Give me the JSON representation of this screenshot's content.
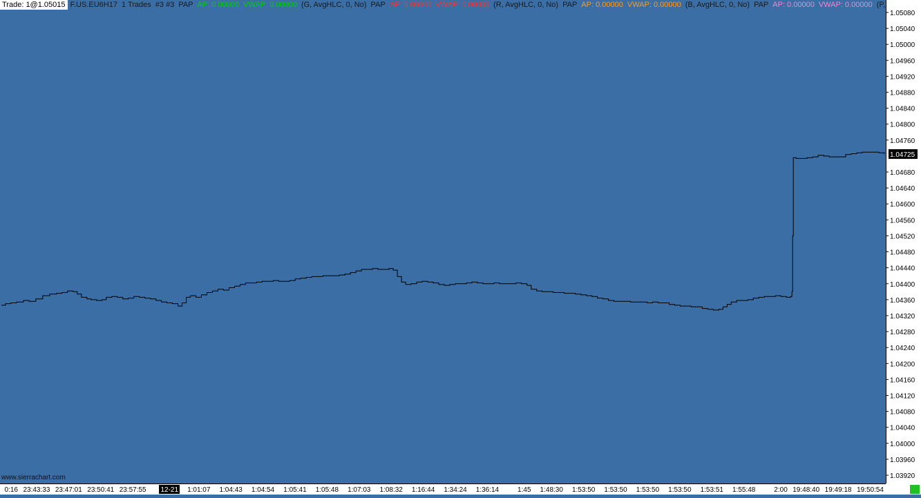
{
  "header": {
    "trade_label": "Trade: 1@1.05015",
    "symbol": "F.US.EU6H17",
    "trades": "1 Trades",
    "chart_id": "#3 #3",
    "items": [
      {
        "text": "PAP",
        "color": "#1a1a1a"
      },
      {
        "text": "AP: 0.00000",
        "color": "#00d000"
      },
      {
        "text": "VWAP: 0.00000",
        "color": "#00d000"
      },
      {
        "text": "(G, AvgHLC, 0, No)",
        "color": "#1a1a1a"
      },
      {
        "text": "PAP",
        "color": "#1a1a1a"
      },
      {
        "text": "AP: 0.00000",
        "color": "#ff3030"
      },
      {
        "text": "VWAP: 0.00000",
        "color": "#ff3030"
      },
      {
        "text": "(R, AvgHLC, 0, No)",
        "color": "#1a1a1a"
      },
      {
        "text": "PAP",
        "color": "#1a1a1a"
      },
      {
        "text": "AP: 0.00000",
        "color": "#ff9a1a"
      },
      {
        "text": "VWAP: 0.00000",
        "color": "#ff9a1a"
      },
      {
        "text": "(B, AvgHLC, 0, No)",
        "color": "#1a1a1a"
      },
      {
        "text": "PAP",
        "color": "#1a1a1a"
      },
      {
        "text": "AP: 0.00000",
        "color": "#ff80d0"
      },
      {
        "text": "VWAP: 0.00000",
        "color": "#ff80d0"
      },
      {
        "text": "(P, A",
        "color": "#1a1a1a"
      }
    ]
  },
  "watermark": "www.sierrachart.com",
  "chart_data": {
    "type": "line",
    "title": "",
    "ylim": [
      1.039,
      1.051
    ],
    "y_ticks": [
      "1.05080",
      "1.05040",
      "1.05000",
      "1.04960",
      "1.04920",
      "1.04880",
      "1.04840",
      "1.04800",
      "1.04760",
      "1.04680",
      "1.04640",
      "1.04600",
      "1.04560",
      "1.04520",
      "1.04480",
      "1.04440",
      "1.04400",
      "1.04360",
      "1.04320",
      "1.04280",
      "1.04240",
      "1.04200",
      "1.04160",
      "1.04120",
      "1.04080",
      "1.04040",
      "1.04000",
      "1.03960",
      "1.03920"
    ],
    "last_price": "1.04725",
    "x_ticks": [
      "0:16",
      "23:43:33",
      "23:47:01",
      "23:50:41",
      "23:57:55",
      "12-21",
      "1:01:07",
      "1:04:43",
      "1:04:54",
      "1:05:41",
      "1:05:48",
      "1:07:03",
      "1:08:32",
      "1:16:44",
      "1:34:24",
      "1:36:14",
      "1:45",
      "1:48:30",
      "1:53:50",
      "1:53:50",
      "1:53:50",
      "1:53:50",
      "1:53:51",
      "1:55:48",
      "2:00",
      "19:48:40",
      "19:49:18",
      "19:50:54"
    ],
    "date_marker_index": 5,
    "bar_index_end": 1280,
    "series": [
      {
        "color": "#000000",
        "points": [
          [
            0,
            1.04346
          ],
          [
            6,
            1.0435
          ],
          [
            14,
            1.04352
          ],
          [
            22,
            1.04354
          ],
          [
            32,
            1.04358
          ],
          [
            40,
            1.04356
          ],
          [
            50,
            1.04362
          ],
          [
            60,
            1.0437
          ],
          [
            70,
            1.04374
          ],
          [
            80,
            1.04376
          ],
          [
            88,
            1.04378
          ],
          [
            96,
            1.04382
          ],
          [
            104,
            1.0438
          ],
          [
            110,
            1.04374
          ],
          [
            116,
            1.04366
          ],
          [
            124,
            1.04362
          ],
          [
            130,
            1.0436
          ],
          [
            138,
            1.04358
          ],
          [
            146,
            1.0436
          ],
          [
            152,
            1.04366
          ],
          [
            160,
            1.04368
          ],
          [
            168,
            1.04366
          ],
          [
            176,
            1.04362
          ],
          [
            184,
            1.04364
          ],
          [
            192,
            1.04368
          ],
          [
            200,
            1.04366
          ],
          [
            208,
            1.04364
          ],
          [
            216,
            1.04362
          ],
          [
            224,
            1.04358
          ],
          [
            232,
            1.04354
          ],
          [
            240,
            1.04352
          ],
          [
            248,
            1.0435
          ],
          [
            256,
            1.04344
          ],
          [
            262,
            1.04352
          ],
          [
            268,
            1.04366
          ],
          [
            274,
            1.0437
          ],
          [
            282,
            1.04366
          ],
          [
            290,
            1.04372
          ],
          [
            298,
            1.04378
          ],
          [
            306,
            1.04382
          ],
          [
            314,
            1.04386
          ],
          [
            322,
            1.04384
          ],
          [
            330,
            1.0439
          ],
          [
            338,
            1.04394
          ],
          [
            346,
            1.04398
          ],
          [
            354,
            1.04402
          ],
          [
            362,
            1.04402
          ],
          [
            370,
            1.04404
          ],
          [
            378,
            1.04406
          ],
          [
            386,
            1.04406
          ],
          [
            394,
            1.04408
          ],
          [
            402,
            1.04406
          ],
          [
            410,
            1.04406
          ],
          [
            418,
            1.04408
          ],
          [
            426,
            1.04412
          ],
          [
            434,
            1.04414
          ],
          [
            442,
            1.04416
          ],
          [
            450,
            1.04418
          ],
          [
            458,
            1.04418
          ],
          [
            466,
            1.0442
          ],
          [
            474,
            1.0442
          ],
          [
            482,
            1.0442
          ],
          [
            490,
            1.04422
          ],
          [
            498,
            1.04424
          ],
          [
            506,
            1.04428
          ],
          [
            514,
            1.04432
          ],
          [
            522,
            1.04436
          ],
          [
            530,
            1.04436
          ],
          [
            538,
            1.04438
          ],
          [
            546,
            1.04436
          ],
          [
            554,
            1.04436
          ],
          [
            562,
            1.04438
          ],
          [
            568,
            1.04434
          ],
          [
            574,
            1.04418
          ],
          [
            580,
            1.04404
          ],
          [
            586,
            1.04398
          ],
          [
            594,
            1.044
          ],
          [
            602,
            1.04404
          ],
          [
            610,
            1.04406
          ],
          [
            618,
            1.04404
          ],
          [
            626,
            1.04402
          ],
          [
            634,
            1.04398
          ],
          [
            642,
            1.04396
          ],
          [
            650,
            1.04398
          ],
          [
            658,
            1.044
          ],
          [
            666,
            1.044
          ],
          [
            674,
            1.04402
          ],
          [
            682,
            1.04404
          ],
          [
            690,
            1.04402
          ],
          [
            698,
            1.044
          ],
          [
            706,
            1.044
          ],
          [
            714,
            1.04402
          ],
          [
            722,
            1.044
          ],
          [
            730,
            1.044
          ],
          [
            738,
            1.044
          ],
          [
            746,
            1.04402
          ],
          [
            754,
            1.044
          ],
          [
            762,
            1.04396
          ],
          [
            768,
            1.04386
          ],
          [
            776,
            1.04382
          ],
          [
            784,
            1.0438
          ],
          [
            792,
            1.0438
          ],
          [
            800,
            1.04378
          ],
          [
            808,
            1.04378
          ],
          [
            816,
            1.04376
          ],
          [
            824,
            1.04376
          ],
          [
            832,
            1.04374
          ],
          [
            840,
            1.04372
          ],
          [
            848,
            1.0437
          ],
          [
            856,
            1.04368
          ],
          [
            864,
            1.04364
          ],
          [
            872,
            1.04362
          ],
          [
            880,
            1.04358
          ],
          [
            888,
            1.04356
          ],
          [
            896,
            1.04356
          ],
          [
            904,
            1.04356
          ],
          [
            912,
            1.04354
          ],
          [
            920,
            1.04354
          ],
          [
            928,
            1.04354
          ],
          [
            936,
            1.04352
          ],
          [
            944,
            1.04354
          ],
          [
            952,
            1.04352
          ],
          [
            960,
            1.04352
          ],
          [
            968,
            1.04348
          ],
          [
            976,
            1.04346
          ],
          [
            984,
            1.04344
          ],
          [
            992,
            1.04344
          ],
          [
            1000,
            1.04342
          ],
          [
            1008,
            1.04342
          ],
          [
            1016,
            1.04338
          ],
          [
            1024,
            1.04336
          ],
          [
            1032,
            1.04334
          ],
          [
            1040,
            1.04336
          ],
          [
            1046,
            1.04342
          ],
          [
            1052,
            1.04348
          ],
          [
            1058,
            1.04354
          ],
          [
            1066,
            1.04358
          ],
          [
            1074,
            1.04358
          ],
          [
            1082,
            1.0436
          ],
          [
            1090,
            1.04364
          ],
          [
            1098,
            1.04366
          ],
          [
            1106,
            1.04368
          ],
          [
            1114,
            1.04368
          ],
          [
            1122,
            1.0437
          ],
          [
            1130,
            1.04368
          ],
          [
            1138,
            1.04366
          ],
          [
            1144,
            1.04368
          ],
          [
            1146,
            1.0438
          ],
          [
            1147,
            1.0452
          ],
          [
            1148,
            1.04716
          ],
          [
            1152,
            1.04714
          ],
          [
            1160,
            1.04714
          ],
          [
            1168,
            1.04716
          ],
          [
            1176,
            1.04718
          ],
          [
            1184,
            1.04722
          ],
          [
            1192,
            1.0472
          ],
          [
            1200,
            1.04718
          ],
          [
            1208,
            1.04718
          ],
          [
            1216,
            1.04718
          ],
          [
            1224,
            1.04724
          ],
          [
            1232,
            1.04726
          ],
          [
            1240,
            1.04728
          ],
          [
            1248,
            1.0473
          ],
          [
            1256,
            1.0473
          ],
          [
            1264,
            1.0473
          ],
          [
            1272,
            1.04728
          ],
          [
            1280,
            1.04725
          ]
        ]
      }
    ]
  }
}
